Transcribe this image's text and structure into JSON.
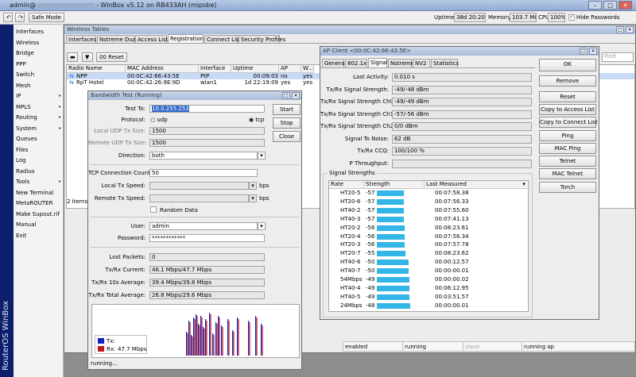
{
  "titlebar": {
    "user": "admin@",
    "title_rest": "- WinBox v5.12 on RB433AH (mipsbe)"
  },
  "toolbar": {
    "safe_mode": "Safe Mode",
    "uptime_label": "Uptime:",
    "uptime": "38d 20:20:58",
    "memory_label": "Memory:",
    "memory": "103.7 MiB",
    "cpu_label": "CPU:",
    "cpu": "100%",
    "hide_passwords": "Hide Passwords"
  },
  "sidebar": {
    "brand": "RouterOS WinBox"
  },
  "menu": [
    {
      "label": "Interfaces",
      "arrow": ""
    },
    {
      "label": "Wireless",
      "arrow": ""
    },
    {
      "label": "Bridge",
      "arrow": ""
    },
    {
      "label": "PPP",
      "arrow": ""
    },
    {
      "label": "Switch",
      "arrow": ""
    },
    {
      "label": "Mesh",
      "arrow": ""
    },
    {
      "label": "IP",
      "arrow": "▸"
    },
    {
      "label": "MPLS",
      "arrow": "▸"
    },
    {
      "label": "Routing",
      "arrow": "▸"
    },
    {
      "label": "System",
      "arrow": "▸"
    },
    {
      "label": "Queues",
      "arrow": ""
    },
    {
      "label": "Files",
      "arrow": ""
    },
    {
      "label": "Log",
      "arrow": ""
    },
    {
      "label": "Radius",
      "arrow": ""
    },
    {
      "label": "Tools",
      "arrow": "▸"
    },
    {
      "label": "New Terminal",
      "arrow": ""
    },
    {
      "label": "MetaROUTER",
      "arrow": ""
    },
    {
      "label": "Make Supout.rif",
      "arrow": ""
    },
    {
      "label": "Manual",
      "arrow": ""
    },
    {
      "label": "Exit",
      "arrow": ""
    }
  ],
  "wireless": {
    "title": "Wireless Tables",
    "tabs": [
      "Interfaces",
      "Nstreme Dual",
      "Access List",
      "Registration",
      "Connect List",
      "Security Profiles"
    ],
    "reset": "Reset",
    "find_placeholder": "Find",
    "columns": [
      "Radio Name",
      "MAC Address",
      "Interface",
      "Uptime",
      "AP",
      "W..."
    ],
    "rows": [
      {
        "name": "NPP",
        "mac": "00:0C:42:66:43:5E",
        "iface": "PtP",
        "uptime": "00:09:03",
        "ap": "no",
        "w": "yes"
      },
      {
        "name": "RpT Hotel",
        "mac": "00:0C:42:26:9E:9D",
        "iface": "wlan1",
        "uptime": "1d 22:19:09",
        "ap": "yes",
        "w": "yes"
      }
    ],
    "items": "2 items (",
    "status": [
      "enabled",
      "running",
      "slave",
      "running ap"
    ]
  },
  "bwtest": {
    "title": "Bandwidth Test (Running)",
    "test_to_label": "Test To:",
    "test_to": "10.0.255.253",
    "protocol_label": "Protocol:",
    "udp": "udp",
    "tcp": "tcp",
    "local_udp_label": "Local UDP Tx Size:",
    "local_udp": "1500",
    "remote_udp_label": "Remote UDP Tx Size:",
    "remote_udp": "1500",
    "direction_label": "Direction:",
    "direction": "both",
    "tcp_conn_label": "TCP Connection Count:",
    "tcp_conn": "50",
    "local_tx_label": "Local Tx Speed:",
    "remote_tx_label": "Remote Tx Speed:",
    "bps": "bps",
    "random_data": "Random Data",
    "user_label": "User:",
    "user": "admin",
    "password_label": "Password:",
    "password": "************",
    "lost_label": "Lost Packets:",
    "lost": "0",
    "current_label": "Tx/Rx Current:",
    "current": "46.1 Mbps/47.7 Mbps",
    "avg10_label": "Tx/Rx 10s Average:",
    "avg10": "39.4 Mbps/39.8 Mbps",
    "total_label": "Tx/Rx Total Average:",
    "total": "26.8 Mbps/29.6 Mbps",
    "legend_tx": "Tx:",
    "legend_rx": "Rx:",
    "legend_rx_val": "47.7 Mbps",
    "status": "running...",
    "buttons": [
      "Start",
      "Stop",
      "Close"
    ],
    "colors": {
      "tx": "#1020c0",
      "rx": "#c01818"
    }
  },
  "apclient": {
    "title": "AP Client <00:0C:42:66:43:5E>",
    "tabs": [
      "General",
      "802.1x",
      "Signal",
      "Nstreme",
      "NV2",
      "Statistics"
    ],
    "fields": [
      {
        "label": "Last Activity:",
        "value": "0.010 s"
      },
      {
        "label": "Tx/Rx Signal Strength:",
        "value": "-49/-48 dBm"
      },
      {
        "label": "Tx/Rx Signal Strength Ch0:",
        "value": "-49/-49 dBm"
      },
      {
        "label": "Tx/Rx Signal Strength Ch1:",
        "value": "-57/-56 dBm"
      },
      {
        "label": "Tx/Rx Signal Strength Ch2:",
        "value": "0/0 dBm"
      },
      {
        "label": "Signal To Noise:",
        "value": "62 dB"
      },
      {
        "label": "Tx/Rx CCQ:",
        "value": "100/100 %"
      },
      {
        "label": "P Throughput:",
        "value": ""
      }
    ],
    "strengths_title": "Signal Strengths",
    "strength_columns": [
      "Rate",
      "Strength",
      "Last Measured"
    ],
    "strengths": [
      {
        "rate": "HT20-5",
        "value": -57,
        "time": "00:07:58.38"
      },
      {
        "rate": "HT20-6",
        "value": -57,
        "time": "00:07:56.33"
      },
      {
        "rate": "HT40-2",
        "value": -57,
        "time": "00:07:55.60"
      },
      {
        "rate": "HT40-3",
        "value": -57,
        "time": "00:07:41.13"
      },
      {
        "rate": "HT20-2",
        "value": -56,
        "time": "00:08:23.61"
      },
      {
        "rate": "HT20-4",
        "value": -56,
        "time": "00:07:56.34"
      },
      {
        "rate": "HT20-3",
        "value": -56,
        "time": "00:07:57.78"
      },
      {
        "rate": "HT20-7",
        "value": -55,
        "time": "00:08:23.62"
      },
      {
        "rate": "HT40-6",
        "value": -50,
        "time": "00:00:12.57"
      },
      {
        "rate": "HT40-7",
        "value": -50,
        "time": "00:00:00.01"
      },
      {
        "rate": "54Mbps",
        "value": -49,
        "time": "00:00:00.02"
      },
      {
        "rate": "HT40-4",
        "value": -49,
        "time": "00:06:12.95"
      },
      {
        "rate": "HT40-5",
        "value": -49,
        "time": "00:03:51.57"
      },
      {
        "rate": "24Mbps",
        "value": -48,
        "time": "00:00:00.01"
      }
    ],
    "buttons": [
      "OK",
      "Remove",
      "Reset",
      "Copy to Access List",
      "Copy to Connect List",
      "Ping",
      "MAC Ping",
      "Telnet",
      "MAC Telnet",
      "Torch"
    ]
  }
}
